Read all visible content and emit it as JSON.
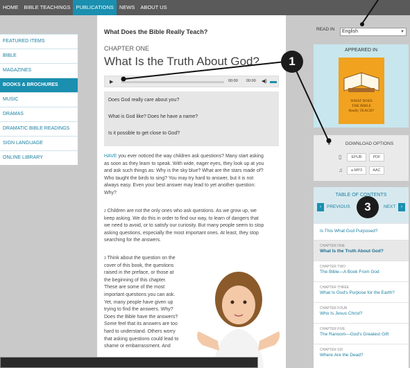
{
  "nav": {
    "items": [
      {
        "label": "HOME",
        "active": false
      },
      {
        "label": "BIBLE TEACHINGS",
        "active": false
      },
      {
        "label": "PUBLICATIONS",
        "active": true
      },
      {
        "label": "NEWS",
        "active": false
      },
      {
        "label": "ABOUT US",
        "active": false
      }
    ]
  },
  "sidebar": {
    "items": [
      {
        "label": "FEATURED ITEMS",
        "active": false
      },
      {
        "label": "BIBLE",
        "active": false
      },
      {
        "label": "MAGAZINES",
        "active": false
      },
      {
        "label": "BOOKS & BROCHURES",
        "active": true
      },
      {
        "label": "MUSIC",
        "active": false
      },
      {
        "label": "DRAMAS",
        "active": false
      },
      {
        "label": "DRAMATIC BIBLE READINGS",
        "active": false
      },
      {
        "label": "SIGN LANGUAGE",
        "active": false
      },
      {
        "label": "ONLINE LIBRARY",
        "active": false
      }
    ]
  },
  "article": {
    "book_title": "What Does the Bible Really Teach?",
    "chapter_label": "CHAPTER ONE",
    "chapter_title": "What Is the Truth About God?",
    "player": {
      "play_symbol": "▶",
      "time_elapsed": "00:00",
      "time_total": "00:00",
      "volume_symbol": "◀)"
    },
    "questions": [
      "Does God really care about you?",
      "What is God like? Does he have a name?",
      "Is it possible to get close to God?"
    ],
    "para1_lead": "HAVE",
    "para1_lines": [
      "you ever noticed the way children ask questions? Many start asking",
      "as soon as they learn to speak. With wide, eager eyes, they look up at you",
      "and ask such things as: Why is the sky blue? What are the stars made of?",
      "Who taught the birds to sing? You may try hard to answer, but it is not",
      "always easy. Even your best answer may lead to yet another question:",
      "Why?"
    ],
    "para2_num": "2",
    "para2_lines": [
      "Children are not the only ones who ask questions. As we grow up, we",
      "keep asking. We do this in order to find our way, to learn of dangers that",
      "we need to avoid, or to satisfy our curiosity. But many people seem to stop",
      "asking questions, especially the most important ones. At least, they stop",
      "searching for the answers."
    ],
    "para3_num": "3",
    "para3_lines": [
      "Think about the question on the",
      "cover of this book, the questions",
      "raised in the preface, or those at",
      "the beginning of this chapter.",
      "These are some of the most",
      "important questions you can ask.",
      "Yet, many people have given up",
      "trying to find the answers. Why?",
      "Does the Bible have the answers?",
      "Some feel that its answers are too",
      "hard to understand. Others worry",
      "that asking questions could lead to",
      "shame or embarrassment. And"
    ]
  },
  "right": {
    "read_in_label": "READ IN",
    "language_value": "English",
    "appeared_in_label": "APPEARED IN",
    "book_cover_text": [
      "WHAT DOES",
      "THE BIBLE",
      "Really TEACH?"
    ],
    "download_label": "DOWNLOAD OPTIONS",
    "download_buttons": [
      "EPUB",
      "PDF",
      "a-MP3",
      "AAC"
    ],
    "toc_label": "TABLE OF CONTENTS",
    "prev_label": "PREVIOUS",
    "next_label": "NEXT",
    "toc_items": [
      {
        "chapter": "",
        "title": "Is This What God Purposed?",
        "active": false
      },
      {
        "chapter": "CHAPTER ONE",
        "title": "What Is the Truth About God?",
        "active": true
      },
      {
        "chapter": "CHAPTER TWO",
        "title": "The Bible—A Book From God",
        "active": false
      },
      {
        "chapter": "CHAPTER THREE",
        "title": "What Is God's Purpose for the Earth?",
        "active": false
      },
      {
        "chapter": "CHAPTER FOUR",
        "title": "Who Is Jesus Christ?",
        "active": false
      },
      {
        "chapter": "CHAPTER FIVE",
        "title": "The Ransom—God's Greatest Gift",
        "active": false
      },
      {
        "chapter": "CHAPTER SIX",
        "title": "Where Are the Dead?",
        "active": false
      }
    ]
  },
  "callouts": {
    "one": "1",
    "three": "3"
  },
  "colors": {
    "accent": "#1a8fb0",
    "nav_bg": "#5a5a5a",
    "book_orange": "#f1a21f"
  }
}
